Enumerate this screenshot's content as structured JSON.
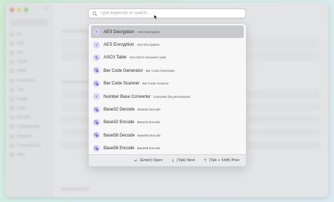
{
  "window": {
    "sidebar": {
      "toggle_icon": "sidebar-toggle-icon",
      "items": [
        "All",
        "URL",
        "API",
        "JSON",
        "YAML",
        "Date/Time",
        "Text",
        "Image",
        "Color",
        "Encode",
        "Cryptography",
        "Network",
        "Programming",
        "Web"
      ]
    }
  },
  "search": {
    "placeholder": "Type keywords to search...",
    "value": "",
    "icon": "search-icon"
  },
  "results": [
    {
      "name": "AES Decryption",
      "desc": "AES Decryption",
      "icon": "crypto-icon",
      "selected": true
    },
    {
      "name": "AES Encryption",
      "desc": "AES Encryption",
      "icon": "crypto-icon"
    },
    {
      "name": "ASCII Table",
      "desc": "Get ASCII character code",
      "icon": "text-icon"
    },
    {
      "name": "Bar Code Generator",
      "desc": "Bar Code Generator",
      "icon": "encode-icon"
    },
    {
      "name": "Bar Code Scanner",
      "desc": "Bar Code Scanner",
      "icon": "encode-icon"
    },
    {
      "name": "Number Base Converter",
      "desc": "Calculate file permissions",
      "icon": "crypto-icon"
    },
    {
      "name": "Base32 Decode",
      "desc": "Base32 Decode",
      "icon": "encode-icon"
    },
    {
      "name": "Base32 Encode",
      "desc": "Base32 Encode",
      "icon": "encode-icon"
    },
    {
      "name": "Base58 Decode",
      "desc": "Base58 Decode",
      "icon": "encode-icon"
    },
    {
      "name": "Base58 Encode",
      "desc": "Base58 Encode",
      "icon": "encode-icon"
    }
  ],
  "footer": {
    "open_key": "↵",
    "open_label": "(Enter) Open",
    "next_key": "↓",
    "next_label": "(Tab) Next",
    "prev_key": "↑",
    "prev_label": "(Tab + Shift) Prev"
  },
  "colors": {
    "accent_icon": "#7b5fd0",
    "selected_row": "#c9cacd",
    "icon_bg": "#ddd8f1"
  }
}
